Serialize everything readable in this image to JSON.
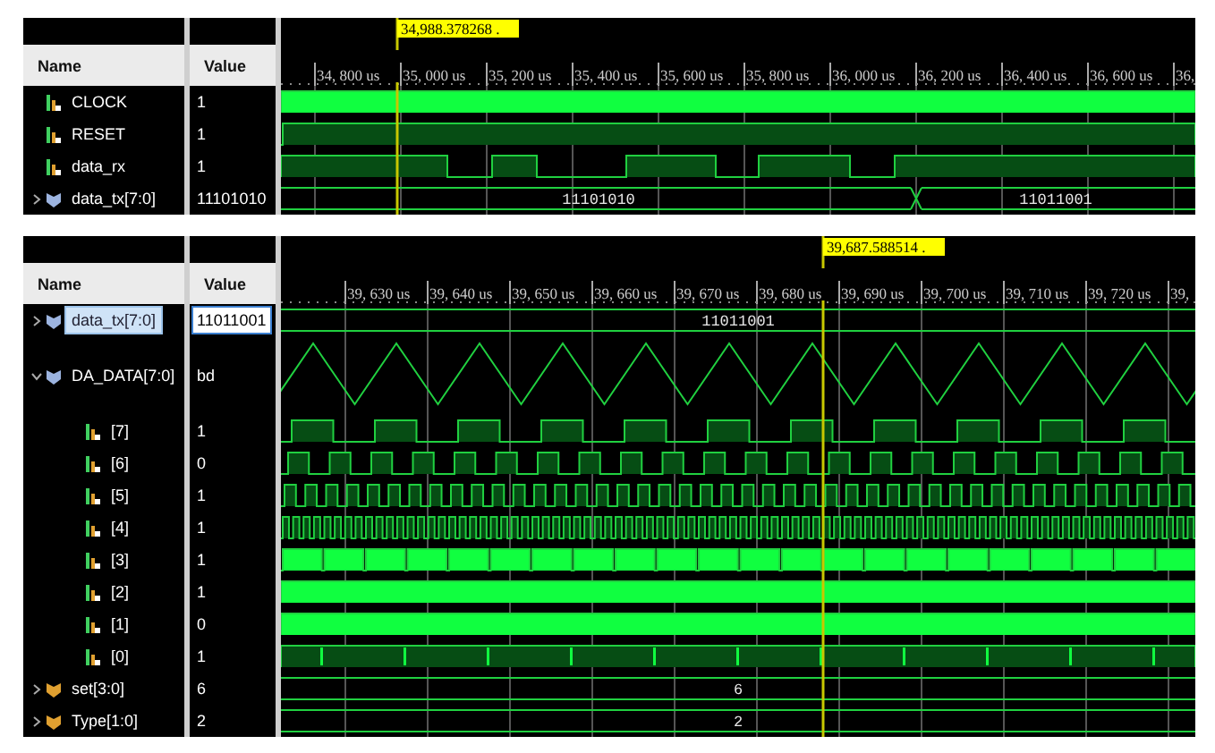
{
  "panels": [
    {
      "cursor_time": "34,988.378268 .",
      "header": {
        "name": "Name",
        "value": "Value"
      },
      "ticks": [
        "34, 800 us",
        "35, 000 us",
        "35, 200 us",
        "35, 400 us",
        "35, 600 us",
        "35, 800 us",
        "36, 000 us",
        "36, 200 us",
        "36, 400 us",
        "36, 600 us",
        "36,"
      ],
      "signals": [
        {
          "name": "CLOCK",
          "kind": "bit",
          "value": "1",
          "selected": false
        },
        {
          "name": "RESET",
          "kind": "bit",
          "value": "1",
          "selected": false
        },
        {
          "name": "data_rx",
          "kind": "bit",
          "value": "1",
          "selected": false
        },
        {
          "name": "data_tx[7:0]",
          "kind": "bus",
          "value": "11101010",
          "selected": false,
          "expanded": false,
          "color": "#9cb4e0",
          "segments": [
            "11101010",
            "11011001"
          ]
        }
      ]
    },
    {
      "cursor_time": "39,687.588514 .",
      "header": {
        "name": "Name",
        "value": "Value"
      },
      "ticks": [
        "39, 630 us",
        "39, 640 us",
        "39, 650 us",
        "39, 660 us",
        "39, 670 us",
        "39, 680 us",
        "39, 690 us",
        "39, 700 us",
        "39, 710 us",
        "39, 720 us",
        "39,"
      ],
      "signals": [
        {
          "name": "data_tx[7:0]",
          "kind": "bus",
          "value": "11011001",
          "selected": true,
          "expanded": false,
          "color": "#9cb4e0",
          "segments": [
            "11011001"
          ]
        },
        {
          "name": "DA_DATA[7:0]",
          "kind": "analog",
          "value": "bd",
          "selected": false,
          "expanded": true,
          "color": "#9cb4e0",
          "children": [
            {
              "name": "[7]",
              "kind": "bit",
              "value": "1",
              "selected": false
            },
            {
              "name": "[6]",
              "kind": "bit",
              "value": "0",
              "selected": false
            },
            {
              "name": "[5]",
              "kind": "bit",
              "value": "1",
              "selected": false
            },
            {
              "name": "[4]",
              "kind": "bit",
              "value": "1",
              "selected": false
            },
            {
              "name": "[3]",
              "kind": "bit",
              "value": "1",
              "selected": false
            },
            {
              "name": "[2]",
              "kind": "bit",
              "value": "1",
              "selected": false
            },
            {
              "name": "[1]",
              "kind": "bit",
              "value": "0",
              "selected": false
            },
            {
              "name": "[0]",
              "kind": "bit",
              "value": "1",
              "selected": false
            }
          ]
        },
        {
          "name": "set[3:0]",
          "kind": "bus",
          "value": "6",
          "selected": false,
          "expanded": false,
          "color": "#e0a030",
          "segments": [
            "6"
          ]
        },
        {
          "name": "Type[1:0]",
          "kind": "bus",
          "value": "2",
          "selected": false,
          "expanded": false,
          "color": "#e0a030",
          "segments": [
            "2"
          ]
        }
      ]
    }
  ]
}
